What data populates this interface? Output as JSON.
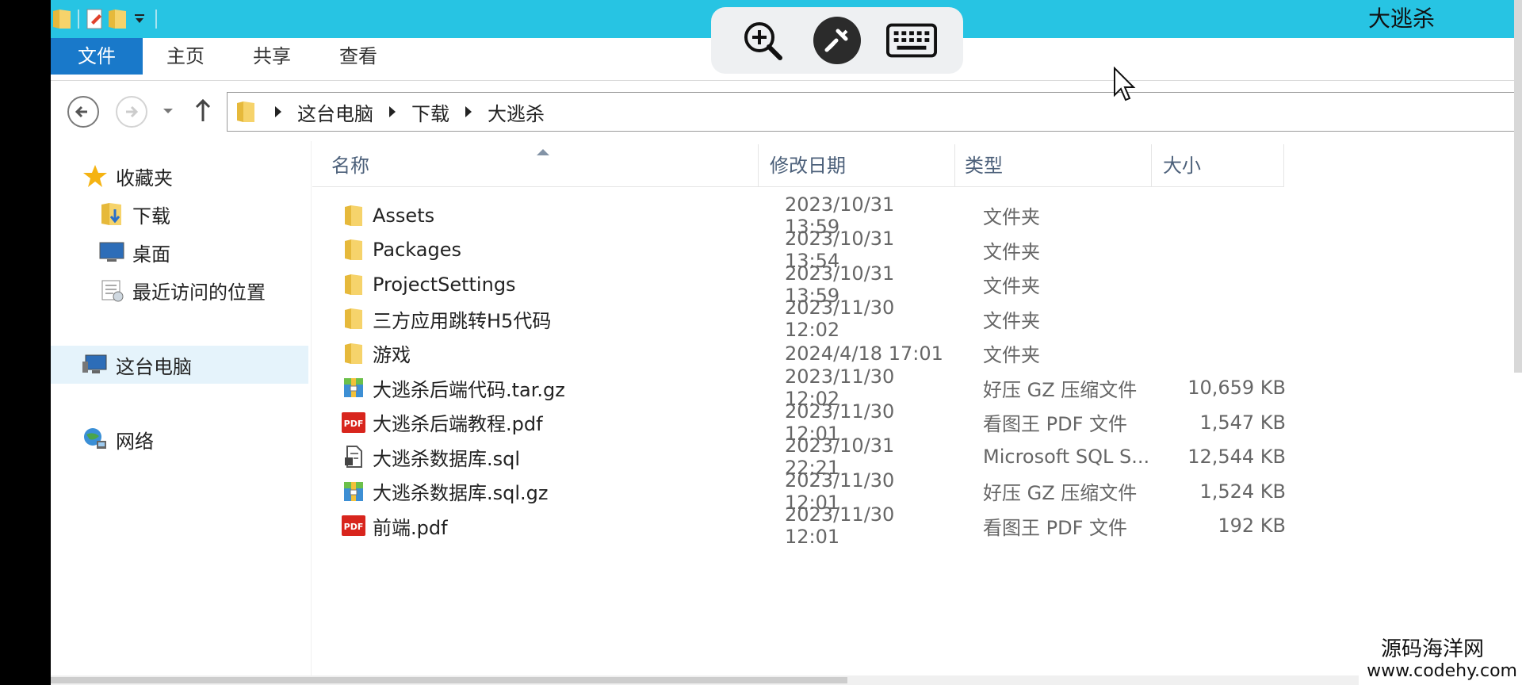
{
  "window": {
    "title": "大逃杀"
  },
  "ribbon": {
    "tabs": [
      {
        "label": "文件"
      },
      {
        "label": "主页"
      },
      {
        "label": "共享"
      },
      {
        "label": "查看"
      }
    ]
  },
  "address": {
    "crumbs": [
      "这台电脑",
      "下载",
      "大逃杀"
    ]
  },
  "sidebar": {
    "favorites_label": "收藏夹",
    "favorites": [
      "下载",
      "桌面",
      "最近访问的位置"
    ],
    "this_pc": "这台电脑",
    "network": "网络"
  },
  "columns": {
    "name": "名称",
    "date": "修改日期",
    "type": "类型",
    "size": "大小"
  },
  "files": [
    {
      "name": "Assets",
      "date": "2023/10/31 13:59",
      "type": "文件夹",
      "size": "",
      "icon": "folder-icon"
    },
    {
      "name": "Packages",
      "date": "2023/10/31 13:54",
      "type": "文件夹",
      "size": "",
      "icon": "folder-icon"
    },
    {
      "name": "ProjectSettings",
      "date": "2023/10/31 13:59",
      "type": "文件夹",
      "size": "",
      "icon": "folder-icon"
    },
    {
      "name": "三方应用跳转H5代码",
      "date": "2023/11/30 12:02",
      "type": "文件夹",
      "size": "",
      "icon": "folder-icon"
    },
    {
      "name": "游戏",
      "date": "2024/4/18 17:01",
      "type": "文件夹",
      "size": "",
      "icon": "folder-icon"
    },
    {
      "name": "大逃杀后端代码.tar.gz",
      "date": "2023/11/30 12:02",
      "type": "好压 GZ 压缩文件",
      "size": "10,659 KB",
      "icon": "archive-icon"
    },
    {
      "name": "大逃杀后端教程.pdf",
      "date": "2023/11/30 12:01",
      "type": "看图王 PDF 文件",
      "size": "1,547 KB",
      "icon": "pdf-icon"
    },
    {
      "name": "大逃杀数据库.sql",
      "date": "2023/10/31 22:21",
      "type": "Microsoft SQL S...",
      "size": "12,544 KB",
      "icon": "sql-file-icon"
    },
    {
      "name": "大逃杀数据库.sql.gz",
      "date": "2023/11/30 12:01",
      "type": "好压 GZ 压缩文件",
      "size": "1,524 KB",
      "icon": "archive-icon"
    },
    {
      "name": "前端.pdf",
      "date": "2023/11/30 12:01",
      "type": "看图王 PDF 文件",
      "size": "192 KB",
      "icon": "pdf-icon"
    }
  ],
  "pdf_badge": "PDF",
  "watermark": {
    "line1": "源码海洋网",
    "line2": "www.codehy.com"
  },
  "colors": {
    "titlebar": "#27c4e3",
    "file_tab": "#1979ca",
    "selection": "#e5f3fb"
  }
}
